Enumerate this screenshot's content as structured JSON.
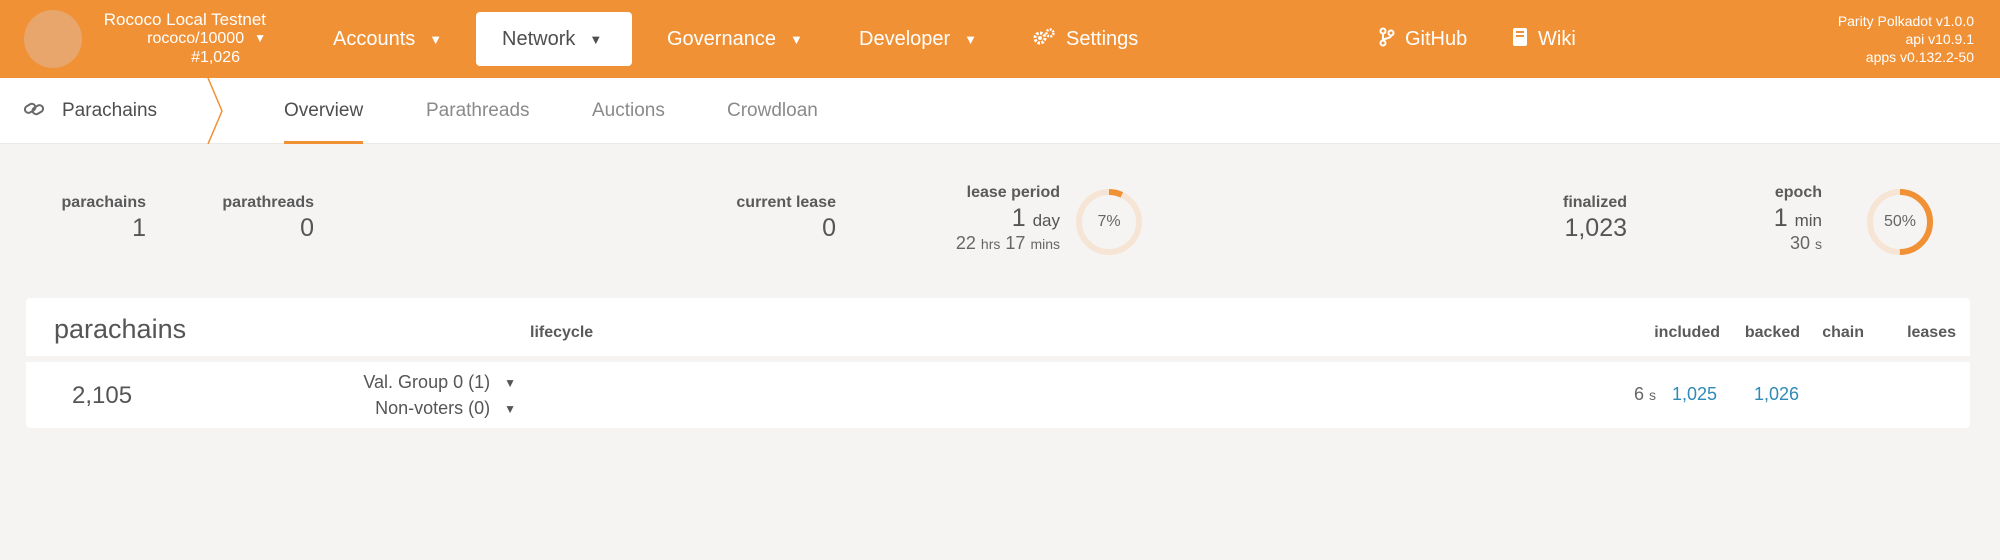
{
  "header": {
    "chain_name": "Rococo Local Testnet",
    "chain_spec": "rococo/10000",
    "block_number": "#1,026",
    "nav": [
      {
        "label": "Accounts"
      },
      {
        "label": "Network"
      },
      {
        "label": "Governance"
      },
      {
        "label": "Developer"
      },
      {
        "label": "Settings"
      },
      {
        "label": "GitHub"
      },
      {
        "label": "Wiki"
      }
    ],
    "versions": {
      "client": "Parity Polkadot v1.0.0",
      "api": "api v10.9.1",
      "apps": "apps v0.132.2-50"
    }
  },
  "subnav": {
    "section": "Parachains",
    "tabs": [
      {
        "label": "Overview"
      },
      {
        "label": "Parathreads"
      },
      {
        "label": "Auctions"
      },
      {
        "label": "Crowdloan"
      }
    ]
  },
  "summary": {
    "parachains": {
      "label": "parachains",
      "value": "1"
    },
    "parathreads": {
      "label": "parathreads",
      "value": "0"
    },
    "current_lease": {
      "label": "current lease",
      "value": "0"
    },
    "lease_period": {
      "label": "lease period",
      "days": "1",
      "days_unit": "day",
      "hrs": "22",
      "hrs_unit": "hrs",
      "mins": "17",
      "mins_unit": "mins",
      "percent_label": "7%",
      "progress": 0.07
    },
    "finalized": {
      "label": "finalized",
      "value": "1,023"
    },
    "epoch": {
      "label": "epoch",
      "min": "1",
      "min_unit": "min",
      "sec": "30",
      "sec_unit": "s",
      "percent_label": "50%",
      "progress": 0.5
    }
  },
  "table": {
    "title": "parachains",
    "columns": {
      "lifecycle": "lifecycle",
      "included": "included",
      "backed": "backed",
      "chain": "chain",
      "leases": "leases"
    },
    "rows": [
      {
        "id": "2,105",
        "val_group": "Val. Group 0 (1)",
        "non_voters": "Non-voters (0)",
        "last_time": "6",
        "last_time_unit": "s",
        "included": "1,025",
        "backed": "1,026"
      }
    ]
  },
  "colors": {
    "accent": "#f19135",
    "link": "#2f8ab5",
    "ring_track": "#f6e5d5"
  }
}
